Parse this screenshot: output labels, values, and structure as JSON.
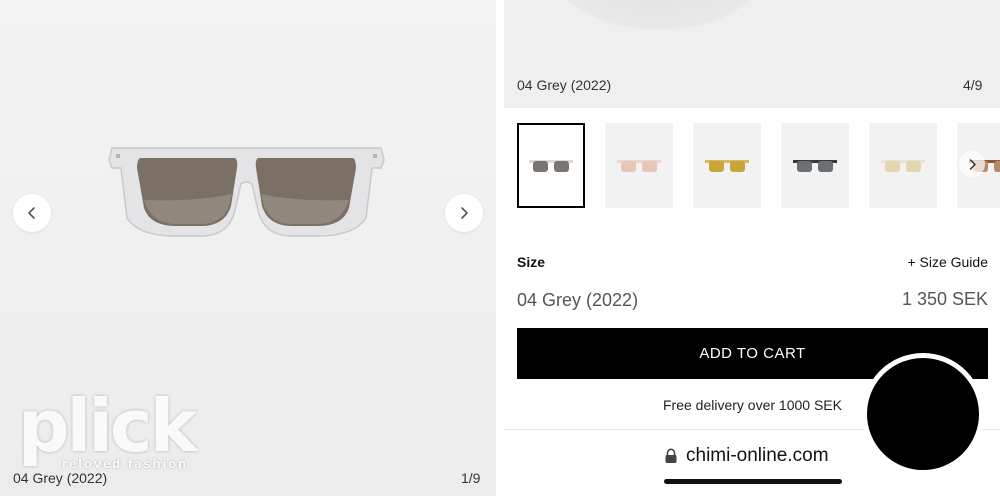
{
  "left_panel": {
    "caption": "04 Grey (2022)",
    "counter": "1/9",
    "prev_icon": "chevron-left-icon",
    "next_icon": "chevron-right-icon",
    "watermark": {
      "word": "plick",
      "tagline": "reloved fashion"
    }
  },
  "right_panel": {
    "hero": {
      "caption": "04 Grey (2022)",
      "counter": "4/9"
    },
    "thumbnails": [
      {
        "name": "grey",
        "lens_color": "#7a7570",
        "frame_color": "#d9d9d9",
        "active": true
      },
      {
        "name": "pink",
        "lens_color": "#e7c6b7",
        "frame_color": "#ecd7cd",
        "active": false
      },
      {
        "name": "yellow",
        "lens_color": "#c9a53b",
        "frame_color": "#d8b859",
        "active": false
      },
      {
        "name": "black",
        "lens_color": "#6d7072",
        "frame_color": "#3a3a3a",
        "active": false
      },
      {
        "name": "cream",
        "lens_color": "#e3d6b0",
        "frame_color": "#e9e3d3",
        "active": false
      },
      {
        "name": "tortoise",
        "lens_color": "#b98a6a",
        "frame_color": "#8a5a3a",
        "active": false
      }
    ],
    "size_label": "Size",
    "size_guide_label": "+ Size Guide",
    "selected_variant": "04 Grey (2022)",
    "price": "1 350 SEK",
    "add_to_cart_label": "ADD TO CART",
    "delivery_note": "Free delivery over 1000 SEK",
    "url": "chimi-online.com"
  }
}
